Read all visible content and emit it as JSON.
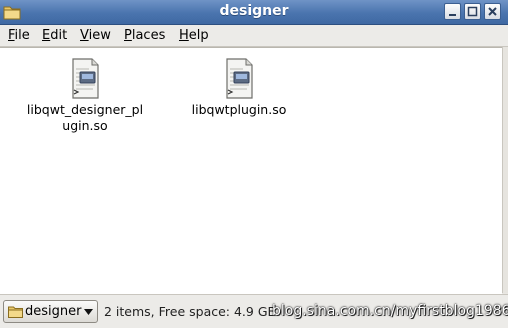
{
  "window": {
    "title": "designer"
  },
  "menubar": {
    "items": [
      {
        "label": "File",
        "mnemonic": "F"
      },
      {
        "label": "Edit",
        "mnemonic": "E"
      },
      {
        "label": "View",
        "mnemonic": "V"
      },
      {
        "label": "Places",
        "mnemonic": "P"
      },
      {
        "label": "Help",
        "mnemonic": "H"
      }
    ]
  },
  "files": [
    {
      "name": "libqwt_designer_plugin.so",
      "icon": "shared-library-icon"
    },
    {
      "name": "libqwtplugin.so",
      "icon": "shared-library-icon"
    }
  ],
  "statusbar": {
    "location": "designer",
    "status": "2 items, Free space: 4.9 GB",
    "watermark": "blog.sina.com.cn/myfirstblog1986"
  },
  "colors": {
    "titlebar": "#4a74ae",
    "content_bg": "#ffffff",
    "chrome_bg": "#ecebe8"
  }
}
